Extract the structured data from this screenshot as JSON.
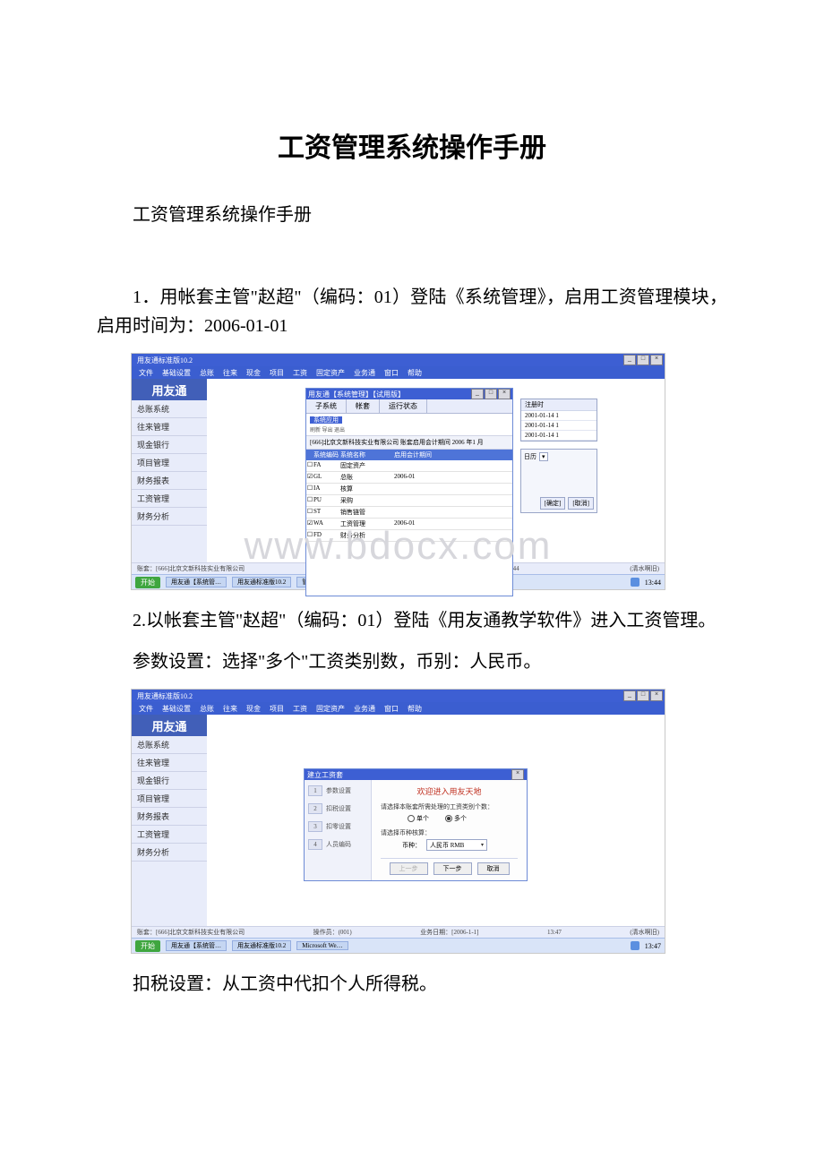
{
  "doc": {
    "title": "工资管理系统操作手册",
    "subtitle": "工资管理系统操作手册",
    "p1": "1．用帐套主管\"赵超\"（编码：01）登陆《系统管理》，启用工资管理模块，启用时间为：2006-01-01",
    "p2": "2.以帐套主管\"赵超\"（编码：01）登陆《用友通教学软件》进入工资管理。",
    "p3": "参数设置：选择\"多个\"工资类别数，币别：人民币。",
    "p4": "扣税设置：从工资中代扣个人所得税。",
    "watermark": "www.bdocx.com"
  },
  "app": {
    "window_title": "用友通标准版10.2",
    "menus": [
      "文件",
      "基础设置",
      "总账",
      "往来",
      "现金",
      "项目",
      "工资",
      "固定资产",
      "业务通",
      "窗口",
      "帮助"
    ],
    "logo": "用友通",
    "sidebar": [
      "总账系统",
      "往来管理",
      "现金银行",
      "项目管理",
      "财务报表",
      "工资管理",
      "财务分析"
    ],
    "status_left": "账套：[666]北京文新科技实业有限公司",
    "status_mid": "操作员：(001)",
    "status_right": "13:44",
    "status_extra": "(清水啊旧)",
    "taskbar_start": "开始",
    "taskbar_items": [
      "用友通【系统管…",
      "用友通标准版10.2",
      "管理器",
      "Microsoft We…"
    ],
    "taskbar_time": "13:44"
  },
  "shot1": {
    "dlg_title": "用友通【系统管理】【试用版】",
    "tabs": [
      "子系统",
      "帐套",
      "运行状态"
    ],
    "tool": "系统应用",
    "tool_icons": "刷新  导出  退出",
    "info": "[666]北京文新科技实业有限公司  账套启用会计期间 2006 年1 月",
    "head_code": "系统编码",
    "head_name": "系统名称",
    "head_date": "启用会计期间",
    "rows": [
      {
        "code": "FA",
        "name": "固定资产",
        "date": ""
      },
      {
        "code": "GL",
        "name": "总账",
        "date": "2006-01"
      },
      {
        "code": "IA",
        "name": "核算",
        "date": ""
      },
      {
        "code": "PU",
        "name": "采购",
        "date": ""
      },
      {
        "code": "ST",
        "name": "销售链管",
        "date": ""
      },
      {
        "code": "WA",
        "name": "工资管理",
        "date": "2006-01"
      },
      {
        "code": "FD",
        "name": "财务分析",
        "date": ""
      }
    ],
    "aux_label": "日历",
    "aux_dates_head": "注册时",
    "aux_dates": [
      "2001-01-14 1",
      "2001-01-14 1",
      "2001-01-14 1"
    ],
    "aux_btn1": "[确定]",
    "aux_btn2": "[取消]"
  },
  "shot2": {
    "dlg_title": "建立工资套",
    "welcome": "欢迎进入用友天地",
    "steps": [
      {
        "n": "1",
        "t": "参数设置"
      },
      {
        "n": "2",
        "t": "扣税设置"
      },
      {
        "n": "3",
        "t": "扣零设置"
      },
      {
        "n": "4",
        "t": "人员编码"
      }
    ],
    "q1": "请选择本账套所需处理的工资类别个数：",
    "r_single": "单个",
    "r_multi": "多个",
    "q2": "请选择币种核算：",
    "currency_label": "币种：",
    "currency_value": "人民币 RMB",
    "btn_prev": "上一步",
    "btn_next": "下一步",
    "btn_cancel": "取消",
    "status_login": "业务日期：[2006-1-1]",
    "status_time": "13:47",
    "taskbar_time": "13:47"
  }
}
